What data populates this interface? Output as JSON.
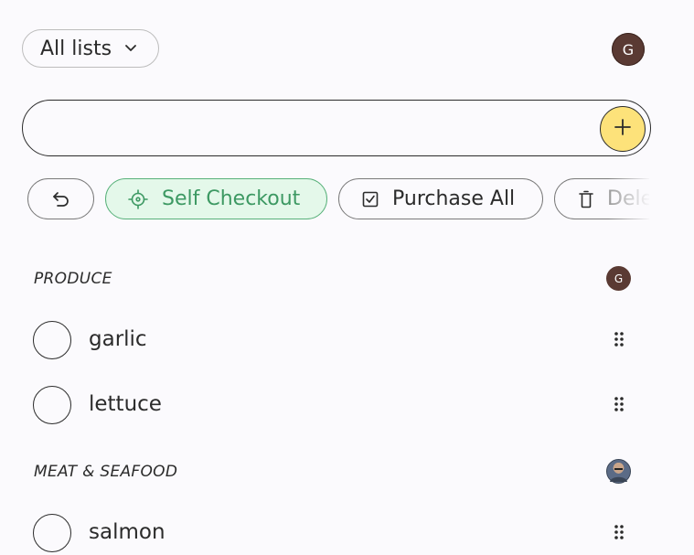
{
  "header": {
    "list_selector": {
      "label": "All lists",
      "icon": "chevron-down-icon"
    },
    "user_avatar_initial": "G"
  },
  "add_item": {
    "value": "",
    "placeholder": "",
    "button_icon": "plus-icon",
    "button_color": "#fde27a"
  },
  "actions": {
    "undo_icon": "undo-icon",
    "self_checkout_label": "Self Checkout",
    "self_checkout_icon": "crosshair-icon",
    "self_checkout_color": "#3d9963",
    "purchase_all_label": "Purchase All",
    "purchase_all_icon": "checkbox-icon",
    "delete_label": "Delete",
    "delete_icon": "trash-icon"
  },
  "sections": [
    {
      "title": "PRODUCE",
      "avatar_initial": "G",
      "items": [
        {
          "name": "garlic"
        },
        {
          "name": "lettuce"
        }
      ]
    },
    {
      "title": "MEAT & SEAFOOD",
      "avatar_initial": "",
      "items": [
        {
          "name": "salmon"
        }
      ]
    }
  ]
}
